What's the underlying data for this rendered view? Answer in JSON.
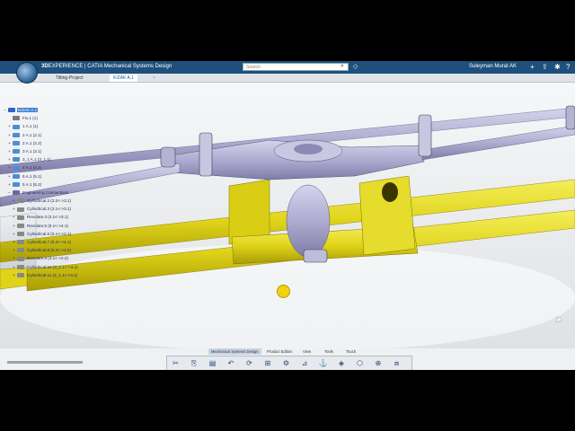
{
  "topbar": {
    "brand_prefix": "3D",
    "brand_main": "EXPERIENCE | CATIA Mechanical Systems Design",
    "search_placeholder": "Search",
    "user_name": "Suleyman Murat AK",
    "icons": [
      "compass-icon",
      "search-icon",
      "tag-icon",
      "plus-icon",
      "share-icon",
      "broadcast-icon",
      "help-icon"
    ]
  },
  "tabs": [
    {
      "label": "Tilting-Project",
      "active": false
    },
    {
      "label": "KIZAK A.1",
      "active": true
    }
  ],
  "tree": [
    {
      "label": "KIZAK A.1",
      "expander": "−",
      "selected": true,
      "color": "#2b66c4",
      "indent": 0
    },
    {
      "label": "Fix.1 (1)",
      "expander": "",
      "selected": false,
      "color": "#7a7a7a",
      "indent": 1
    },
    {
      "label": "1 A.1 (1)",
      "expander": "+",
      "selected": false,
      "color": "#4a8ed8",
      "indent": 1
    },
    {
      "label": "2 A.1 (2.1)",
      "expander": "+",
      "selected": false,
      "color": "#4a8ed8",
      "indent": 1
    },
    {
      "label": "2 A.1 (2.2)",
      "expander": "+",
      "selected": false,
      "color": "#4a8ed8",
      "indent": 1
    },
    {
      "label": "3 A.1 (3.1)",
      "expander": "+",
      "selected": false,
      "color": "#4a8ed8",
      "indent": 1
    },
    {
      "label": "3_1 A.1 (3_1.1)",
      "expander": "+",
      "selected": false,
      "color": "#4a8ed8",
      "indent": 1
    },
    {
      "label": "4 A.1 (4.1)",
      "expander": "+",
      "selected": false,
      "color": "#4a8ed8",
      "indent": 1
    },
    {
      "label": "5 A.1 (5.1)",
      "expander": "+",
      "selected": false,
      "color": "#4a8ed8",
      "indent": 1
    },
    {
      "label": "5 A.1 (5.2)",
      "expander": "+",
      "selected": false,
      "color": "#4a8ed8",
      "indent": 1
    },
    {
      "label": "Engineering Connections",
      "expander": "−",
      "selected": false,
      "color": "#6a6a9a",
      "indent": 1
    },
    {
      "label": "Cylindrical.2 (2.2<->3.1)",
      "expander": "+",
      "selected": false,
      "color": "#888",
      "indent": 2
    },
    {
      "label": "Cylindrical.3 (2.1<->3.1)",
      "expander": "+",
      "selected": false,
      "color": "#888",
      "indent": 2
    },
    {
      "label": "Revolute.4 (4.1<->3.1)",
      "expander": "+",
      "selected": false,
      "color": "#888",
      "indent": 2
    },
    {
      "label": "Revolute.5 (5.1<->4.1)",
      "expander": "+",
      "selected": false,
      "color": "#888",
      "indent": 2
    },
    {
      "label": "Cylindrical.6 (5.1<->2.1)",
      "expander": "+",
      "selected": false,
      "color": "#888",
      "indent": 2
    },
    {
      "label": "Cylindrical.7 (5.2<->4.1)",
      "expander": "+",
      "selected": false,
      "color": "#888",
      "indent": 2
    },
    {
      "label": "Cylindrical.8 (5.2<->2.2)",
      "expander": "+",
      "selected": false,
      "color": "#888",
      "indent": 2
    },
    {
      "label": "Revolute.9 (3.1<->2.2)",
      "expander": "+",
      "selected": false,
      "color": "#888",
      "indent": 2
    },
    {
      "label": "Cylindrical.10 (3_1.1<->3.1)",
      "expander": "+",
      "selected": false,
      "color": "#888",
      "indent": 2
    },
    {
      "label": "Cylindrical.11 (3_1.1<->3.1)",
      "expander": "+",
      "selected": false,
      "color": "#888",
      "indent": 2
    }
  ],
  "action_tabs": [
    {
      "label": "Mechanical Systems Design",
      "active": true
    },
    {
      "label": "Product Edition",
      "active": false
    },
    {
      "label": "View",
      "active": false
    },
    {
      "label": "Tools",
      "active": false
    },
    {
      "label": "Touch",
      "active": false
    }
  ],
  "action_buttons": [
    {
      "name": "cut-icon",
      "glyph": "✂"
    },
    {
      "name": "copy-icon",
      "glyph": "⎘"
    },
    {
      "name": "paste-icon",
      "glyph": "▤"
    },
    {
      "name": "undo-icon",
      "glyph": "↶"
    },
    {
      "name": "update-icon",
      "glyph": "⟳"
    },
    {
      "name": "insert-product-icon",
      "glyph": "⊞"
    },
    {
      "name": "engineering-connection-icon",
      "glyph": "⚙"
    },
    {
      "name": "measure-icon",
      "glyph": "⊿"
    },
    {
      "name": "fix-icon",
      "glyph": "⚓"
    },
    {
      "name": "clash-icon",
      "glyph": "◈"
    },
    {
      "name": "explode-icon",
      "glyph": "⬡"
    },
    {
      "name": "snap-icon",
      "glyph": "⊕"
    },
    {
      "name": "section-icon",
      "glyph": "⧈"
    }
  ],
  "colors": {
    "topbar": "#1f4f7c",
    "part_yellow": "#e8de1a",
    "part_purple": "#b7b5d6",
    "selection": "#3d7fd0"
  }
}
